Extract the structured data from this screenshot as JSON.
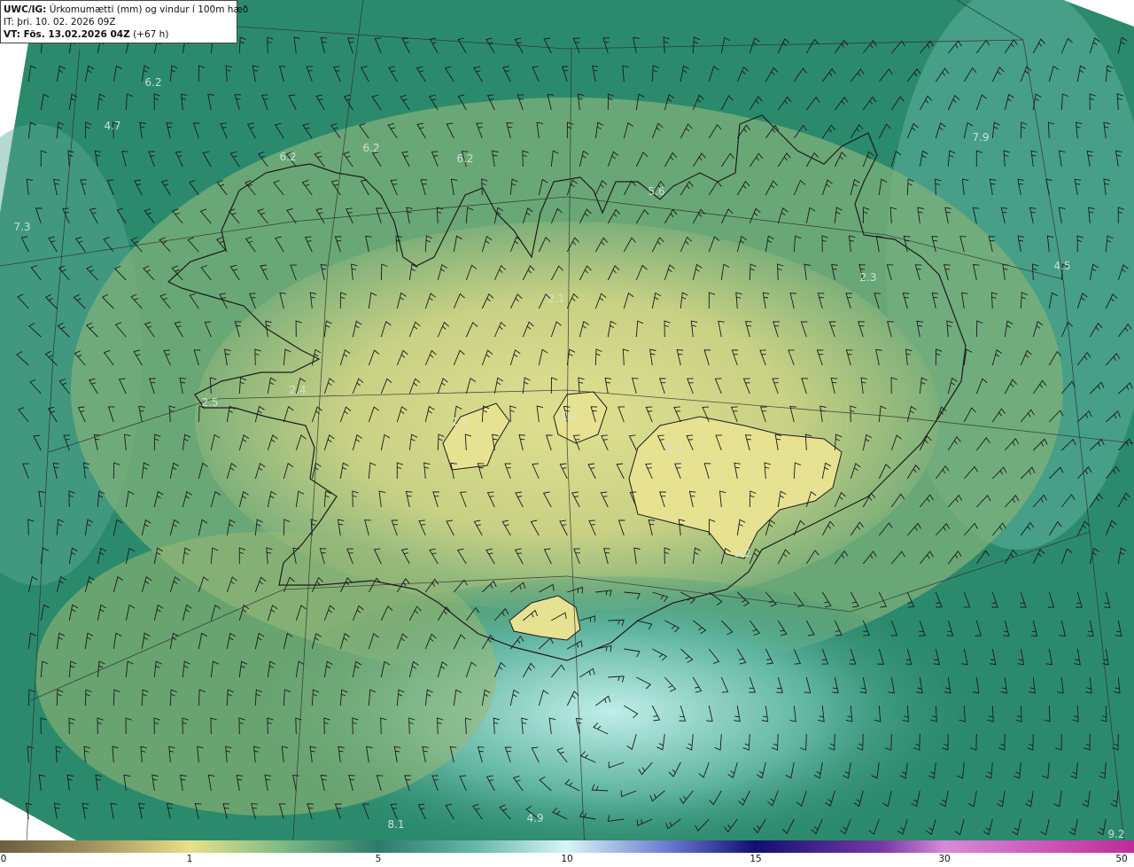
{
  "header": {
    "product_label": "UWC/IG:",
    "product_desc": "Úrkomumætti (mm) og vindur í 100m hæð",
    "it_line": "IT: þri. 10. 02. 2026 09Z",
    "vt_label": "VT: Fös. 13.02.2026 04Z",
    "vt_offset": "(+67 h)"
  },
  "colorbar": {
    "ticks": [
      "0",
      "1",
      "5",
      "10",
      "15",
      "30",
      "50"
    ],
    "colors": [
      "#6b5f3f",
      "#b7a66a",
      "#e8e08a",
      "#4f9a80",
      "#2d7a6a",
      "#b9ecec",
      "#d9f5f5",
      "#2a2f9a",
      "#101070",
      "#9a3fb0",
      "#d88ad8",
      "#c02a9a"
    ]
  },
  "map": {
    "sea_color": "#2c8a6c",
    "land_color": "#d4d68a",
    "value_labels": [
      "6.2",
      "4.7",
      "6.2",
      "6.2",
      "6.2",
      "5.6",
      "7.3",
      "7.9",
      "2.3",
      "4.5",
      "2.4",
      "2.5",
      "1.5",
      "1.2",
      "1.2",
      "1.2",
      "4.9",
      "8.1",
      "9.2",
      "2.1"
    ]
  }
}
